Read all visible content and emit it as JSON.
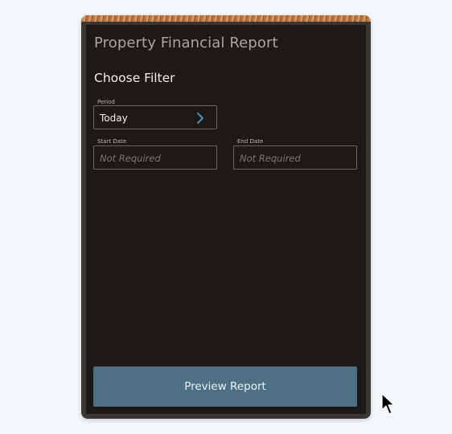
{
  "header": {
    "title": "Property Financial Report"
  },
  "filter": {
    "section_title": "Choose Filter",
    "period": {
      "label": "Period",
      "value": "Today",
      "icon": "chevron-right-icon"
    },
    "start_date": {
      "label": "Start Date",
      "placeholder": "Not Required"
    },
    "end_date": {
      "label": "End Date",
      "placeholder": "Not Required"
    }
  },
  "actions": {
    "preview_label": "Preview Report"
  },
  "colors": {
    "panel_background": "#1c1917",
    "button_background": "#4d7084",
    "accent_stripe": "#b5733e"
  }
}
